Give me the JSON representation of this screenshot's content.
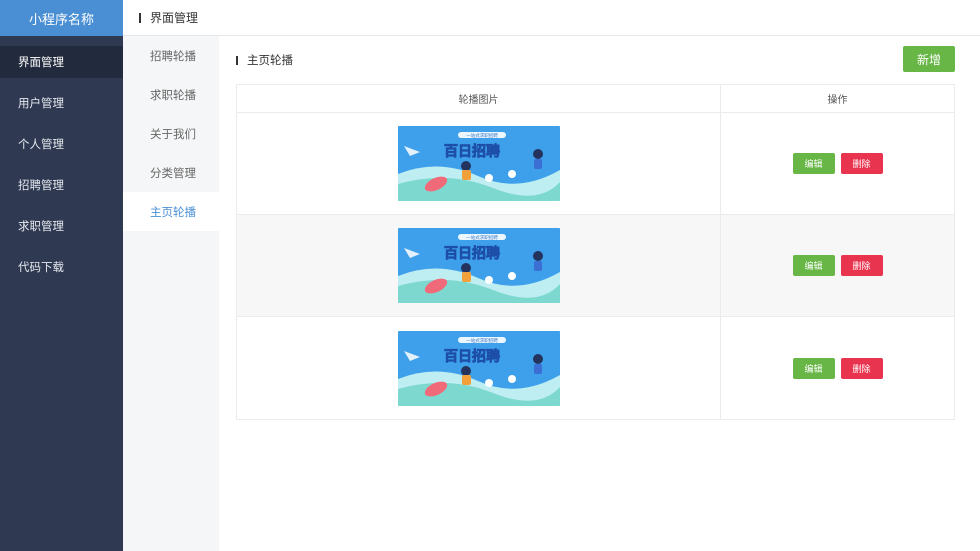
{
  "app": {
    "title": "小程序名称"
  },
  "sidebar": {
    "items": [
      {
        "label": "界面管理",
        "active": true
      },
      {
        "label": "用户管理",
        "active": false
      },
      {
        "label": "个人管理",
        "active": false
      },
      {
        "label": "招聘管理",
        "active": false
      },
      {
        "label": "求职管理",
        "active": false
      },
      {
        "label": "代码下载",
        "active": false
      }
    ]
  },
  "header": {
    "title": "界面管理"
  },
  "submenu": {
    "items": [
      {
        "label": "招聘轮播",
        "active": false
      },
      {
        "label": "求职轮播",
        "active": false
      },
      {
        "label": "关于我们",
        "active": false
      },
      {
        "label": "分类管理",
        "active": false
      },
      {
        "label": "主页轮播",
        "active": true
      }
    ]
  },
  "main": {
    "section_title": "主页轮播",
    "add_label": "新增",
    "table": {
      "columns": [
        "轮播图片",
        "操作"
      ],
      "rows": [
        {
          "banner_text": "百日招聘",
          "banner_tag": "一站式求职招聘",
          "edit_label": "编辑",
          "delete_label": "删除"
        },
        {
          "banner_text": "百日招聘",
          "banner_tag": "一站式求职招聘",
          "edit_label": "编辑",
          "delete_label": "删除"
        },
        {
          "banner_text": "百日招聘",
          "banner_tag": "一站式求职招聘",
          "edit_label": "编辑",
          "delete_label": "删除"
        }
      ]
    }
  },
  "colors": {
    "sidebar_bg": "#2f3a52",
    "logo_bg": "#4a8fd4",
    "accent": "#4a8fd4",
    "add_button": "#67b646",
    "edit_button": "#67b646",
    "delete_button": "#e8344f"
  }
}
